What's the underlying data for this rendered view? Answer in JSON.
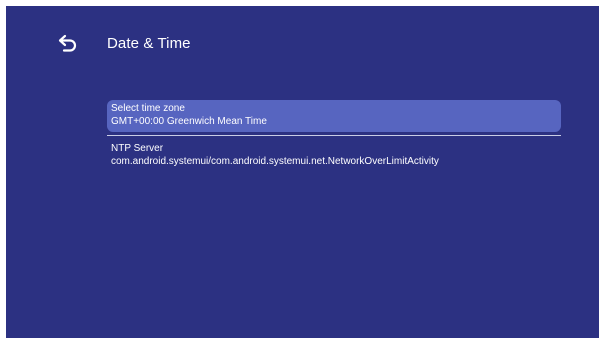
{
  "header": {
    "title": "Date & Time",
    "back_icon": "back-arrow-icon"
  },
  "settings": {
    "items": [
      {
        "label": "Select time zone",
        "value": "GMT+00:00 Greenwich Mean Time",
        "focused": true
      },
      {
        "label": "NTP Server",
        "value": "com.android.systemui/com.android.systemui.net.NetworkOverLimitActivity",
        "focused": false
      }
    ]
  },
  "colors": {
    "background": "#2c3182",
    "focused_item": "#5765c0",
    "text": "#ffffff"
  }
}
